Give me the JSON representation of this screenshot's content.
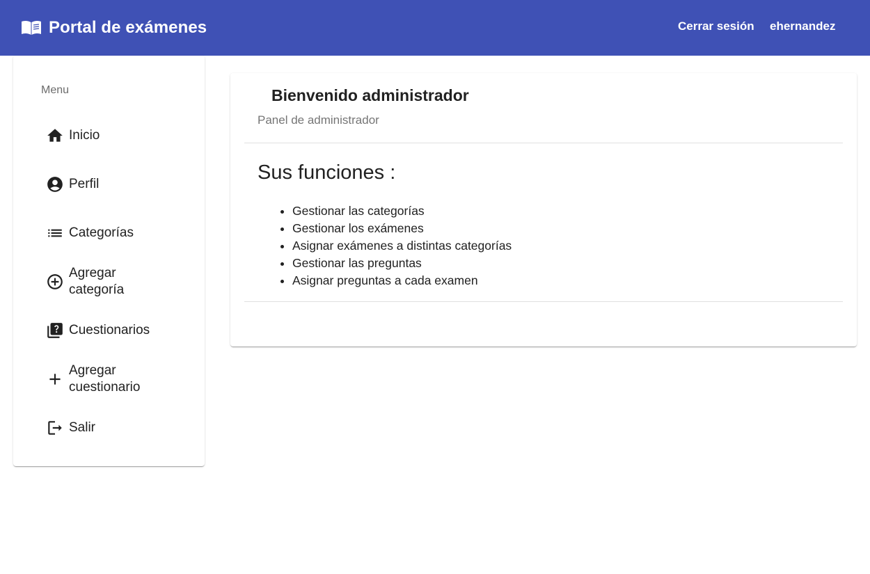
{
  "header": {
    "title": "Portal de exámenes",
    "brand_icon": "open-book-icon",
    "logout_label": "Cerrar sesión",
    "username": "ehernandez",
    "bg_color": "#3f51b5"
  },
  "sidebar": {
    "header": "Menu",
    "items": [
      {
        "label": "Inicio",
        "icon": "home-icon"
      },
      {
        "label": "Perfil",
        "icon": "account-circle-icon"
      },
      {
        "label": "Categorías",
        "icon": "list-icon"
      },
      {
        "label": "Agregar categoría",
        "icon": "add-circle-outline-icon"
      },
      {
        "label": "Cuestionarios",
        "icon": "quiz-icon"
      },
      {
        "label": "Agregar cuestionario",
        "icon": "plus-icon"
      },
      {
        "label": "Salir",
        "icon": "logout-icon"
      }
    ]
  },
  "main": {
    "title": "Bienvenido administrador",
    "subtitle": "Panel de administrador",
    "section_title": "Sus funciones :",
    "functions": [
      "Gestionar las categorías",
      "Gestionar los exámenes",
      "Asignar exámenes a distintas categorías",
      "Gestionar las preguntas",
      "Asignar preguntas a cada examen"
    ]
  }
}
